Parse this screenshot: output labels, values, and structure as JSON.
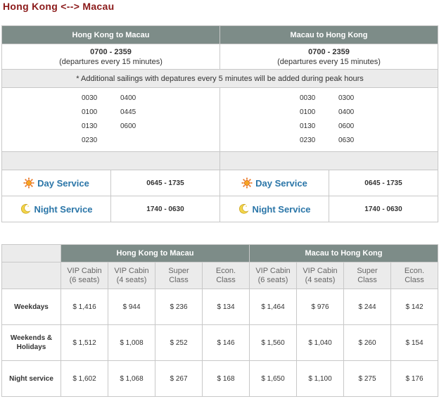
{
  "title": "Hong Kong <--> Macau",
  "schedule": {
    "headers": [
      "Hong Kong to Macau",
      "Macau to Hong Kong"
    ],
    "hours": [
      {
        "range": "0700 - 2359",
        "detail": "(departures every 15 minutes)"
      },
      {
        "range": "0700 - 2359",
        "detail": "(departures every 15 minutes)"
      }
    ],
    "note": "* Additional sailings with depatures every 5 minutes will be added during peak hours",
    "times": [
      [
        "0030",
        "0400",
        "0100",
        "0445",
        "0130",
        "0600",
        "0230",
        ""
      ],
      [
        "0030",
        "0300",
        "0100",
        "0400",
        "0130",
        "0600",
        "0230",
        "0630"
      ]
    ],
    "services": [
      {
        "label": "Day Service",
        "icon": "sun-icon",
        "time": "0645 - 1735"
      },
      {
        "label": "Night Service",
        "icon": "moon-icon",
        "time": "1740 - 0630"
      }
    ]
  },
  "prices": {
    "headers": [
      "Hong Kong to Macau",
      "Macau to Hong Kong"
    ],
    "classes": [
      [
        "VIP Cabin",
        "(6 seats)"
      ],
      [
        "VIP Cabin",
        "(4 seats)"
      ],
      [
        "Super",
        "Class"
      ],
      [
        "Econ.",
        "Class"
      ]
    ],
    "rows": [
      {
        "label": [
          "Weekdays"
        ],
        "values": [
          "$ 1,416",
          "$ 944",
          "$ 236",
          "$ 134",
          "$ 1,464",
          "$ 976",
          "$ 244",
          "$ 142"
        ]
      },
      {
        "label": [
          "Weekends &",
          "Holidays"
        ],
        "values": [
          "$ 1,512",
          "$ 1,008",
          "$ 252",
          "$ 146",
          "$ 1,560",
          "$ 1,040",
          "$ 260",
          "$ 154"
        ]
      },
      {
        "label": [
          "Night service"
        ],
        "values": [
          "$ 1,602",
          "$ 1,068",
          "$ 267",
          "$ 168",
          "$ 1,650",
          "$ 1,100",
          "$ 275",
          "$ 176"
        ]
      }
    ]
  },
  "colors": {
    "title": "#8b1a1a",
    "header_bg": "#7d8c88",
    "service_text": "#2b76a8",
    "shade_bg": "#ebebeb"
  }
}
